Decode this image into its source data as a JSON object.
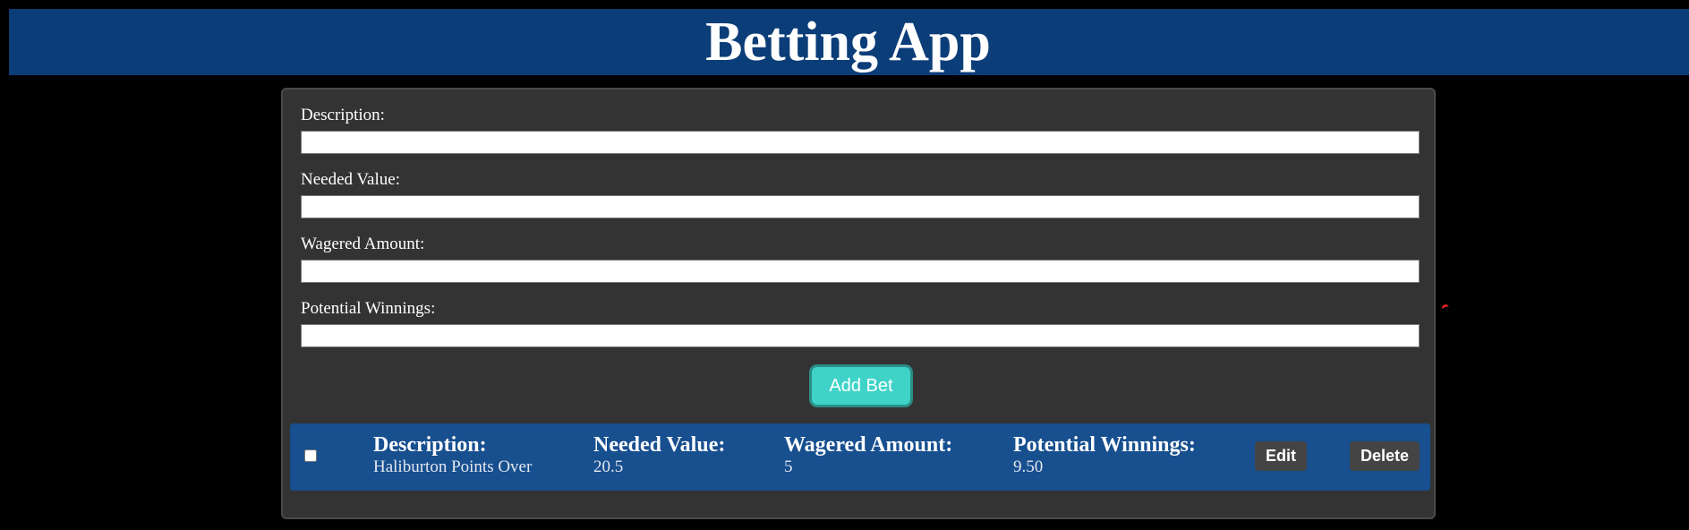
{
  "header": {
    "title": "Betting App",
    "background_color": "#0b3d78"
  },
  "form": {
    "fields": [
      {
        "label": "Description:",
        "value": ""
      },
      {
        "label": "Needed Value:",
        "value": ""
      },
      {
        "label": "Wagered Amount:",
        "value": ""
      },
      {
        "label": "Potential Winnings:",
        "value": ""
      }
    ],
    "add_button_label": "Add Bet",
    "add_button_color": "#3fd3c8"
  },
  "bets": [
    {
      "checked": false,
      "description_label": "Description:",
      "description": "Haliburton Points Over",
      "needed_value_label": "Needed Value:",
      "needed_value": "20.5",
      "wagered_amount_label": "Wagered Amount:",
      "wagered_amount": "5",
      "potential_winnings_label": "Potential Winnings:",
      "potential_winnings": "9.50",
      "edit_label": "Edit",
      "delete_label": "Delete"
    }
  ],
  "colors": {
    "page_background": "#000000",
    "panel_background": "#333333",
    "bet_row_background": "#174f8f",
    "row_button_background": "#444444"
  }
}
